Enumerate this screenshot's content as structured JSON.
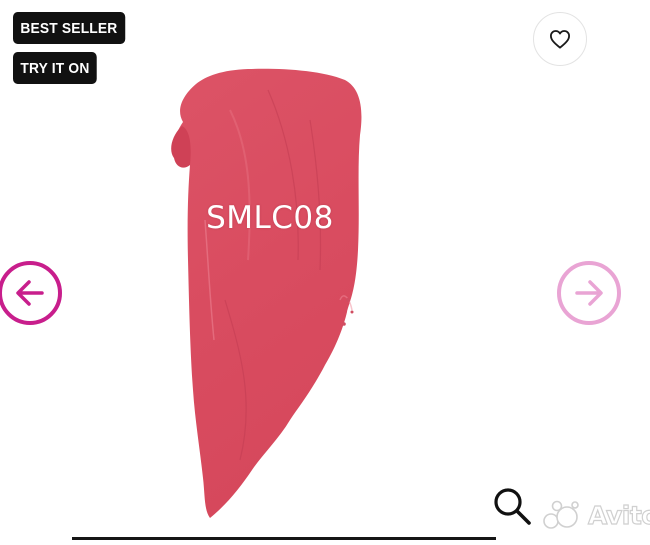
{
  "badges": {
    "best_seller": "BEST SELLER",
    "try_it_on": "TRY IT ON"
  },
  "product": {
    "shade_code": "SMLC08",
    "swatch_color": "#d94f62"
  },
  "icons": {
    "favorite": "heart-icon",
    "previous": "arrow-left-icon",
    "next": "arrow-right-icon",
    "zoom": "magnifier-icon",
    "watermark": "avito-logo"
  },
  "watermark": {
    "text": "Avito"
  },
  "colors": {
    "nav_prev": "#c81e8c",
    "nav_next": "#e9a4d4",
    "badge_bg": "#111111"
  }
}
